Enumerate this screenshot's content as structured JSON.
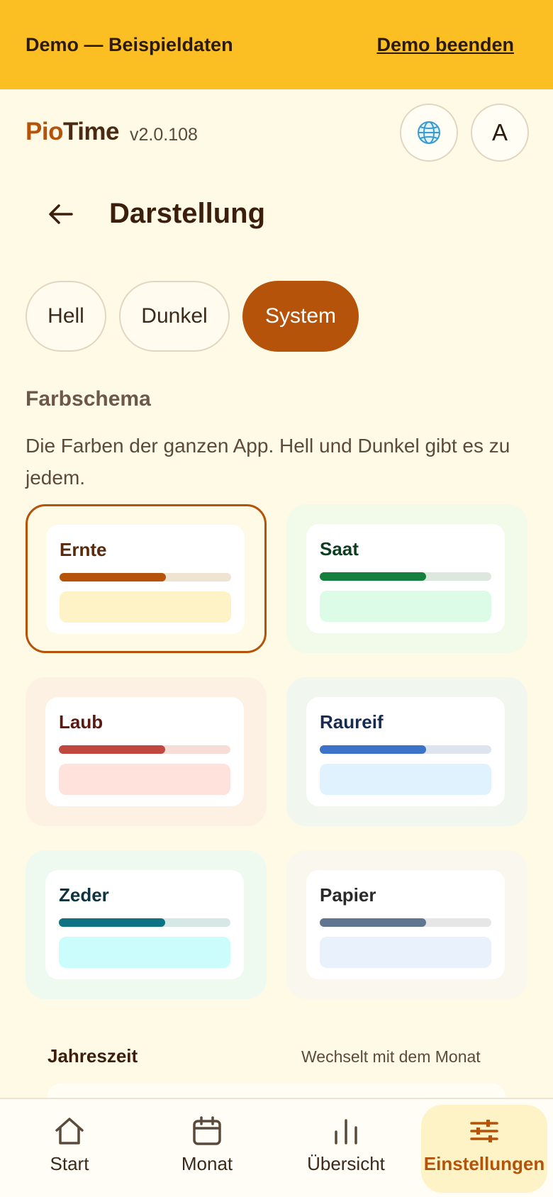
{
  "banner": {
    "text": "Demo — Beispieldaten",
    "action": "Demo beenden"
  },
  "app": {
    "brand_part1": "Pio",
    "brand_part2": "Time",
    "version": "v2.0.108",
    "avatar_initial": "A"
  },
  "page": {
    "title": "Darstellung"
  },
  "theme_mode": {
    "options": [
      "Hell",
      "Dunkel",
      "System"
    ],
    "selected": "System"
  },
  "color_scheme": {
    "title": "Farbschema",
    "description": "Die Farben der ganzen App. Hell und Dunkel gibt es zu jedem.",
    "selected": "Ernte",
    "schemes": [
      {
        "name": "Ernte",
        "accent": "#b45309",
        "text": "#5a2a0c",
        "track": "#efe4d2",
        "swatch": "#fef3c7",
        "bg": "transparent"
      },
      {
        "name": "Saat",
        "accent": "#15803d",
        "text": "#0f3d21",
        "track": "#dce8de",
        "swatch": "#dcfce7",
        "bg": "#f2fbe9"
      },
      {
        "name": "Laub",
        "accent": "#c0473f",
        "text": "#5a1a12",
        "track": "#f6ddd6",
        "swatch": "#fee2db",
        "bg": "#fdf1e4"
      },
      {
        "name": "Raureif",
        "accent": "#3b73c9",
        "text": "#172b52",
        "track": "#dde4ee",
        "swatch": "#dff2fd",
        "bg": "#f1f7ef"
      },
      {
        "name": "Zeder",
        "accent": "#0e7282",
        "text": "#0d3340",
        "track": "#d6e8e6",
        "swatch": "#cbfdfc",
        "bg": "#eefaf0"
      },
      {
        "name": "Papier",
        "accent": "#5f7590",
        "text": "#2a2a2a",
        "track": "#e6e6e6",
        "swatch": "#e9f2fc",
        "bg": "#f9f7ee"
      }
    ],
    "fill_fraction": 0.62
  },
  "season": {
    "label": "Jahreszeit",
    "hint": "Wechselt mit dem Monat"
  },
  "nav": {
    "items": [
      {
        "label": "Start",
        "icon": "home-icon"
      },
      {
        "label": "Monat",
        "icon": "calendar-icon"
      },
      {
        "label": "Übersicht",
        "icon": "bar-chart-icon"
      },
      {
        "label": "Einstellungen",
        "icon": "sliders-icon"
      }
    ],
    "active": "Einstellungen"
  }
}
